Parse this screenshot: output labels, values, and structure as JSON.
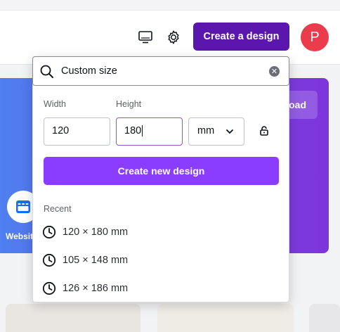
{
  "header": {
    "create_button_label": "Create a design",
    "avatar_initial": "P",
    "icons": [
      "desktop-icon",
      "settings-gear-icon"
    ]
  },
  "background": {
    "hero_button_fragment": "oad",
    "website_label": "Websit"
  },
  "dropdown": {
    "search_value": "Custom size",
    "width_label": "Width",
    "height_label": "Height",
    "width_value": "120",
    "height_value": "180",
    "unit_value": "mm",
    "create_button_label": "Create new design",
    "recent_title": "Recent",
    "recent_items": [
      {
        "label": "120 × 180 mm"
      },
      {
        "label": "105 × 148 mm"
      },
      {
        "label": "126 × 186 mm"
      }
    ]
  },
  "colors": {
    "primary_purple": "#5b16ad",
    "accent_purple": "#8b3dff",
    "avatar_red": "#eb3c4c"
  }
}
